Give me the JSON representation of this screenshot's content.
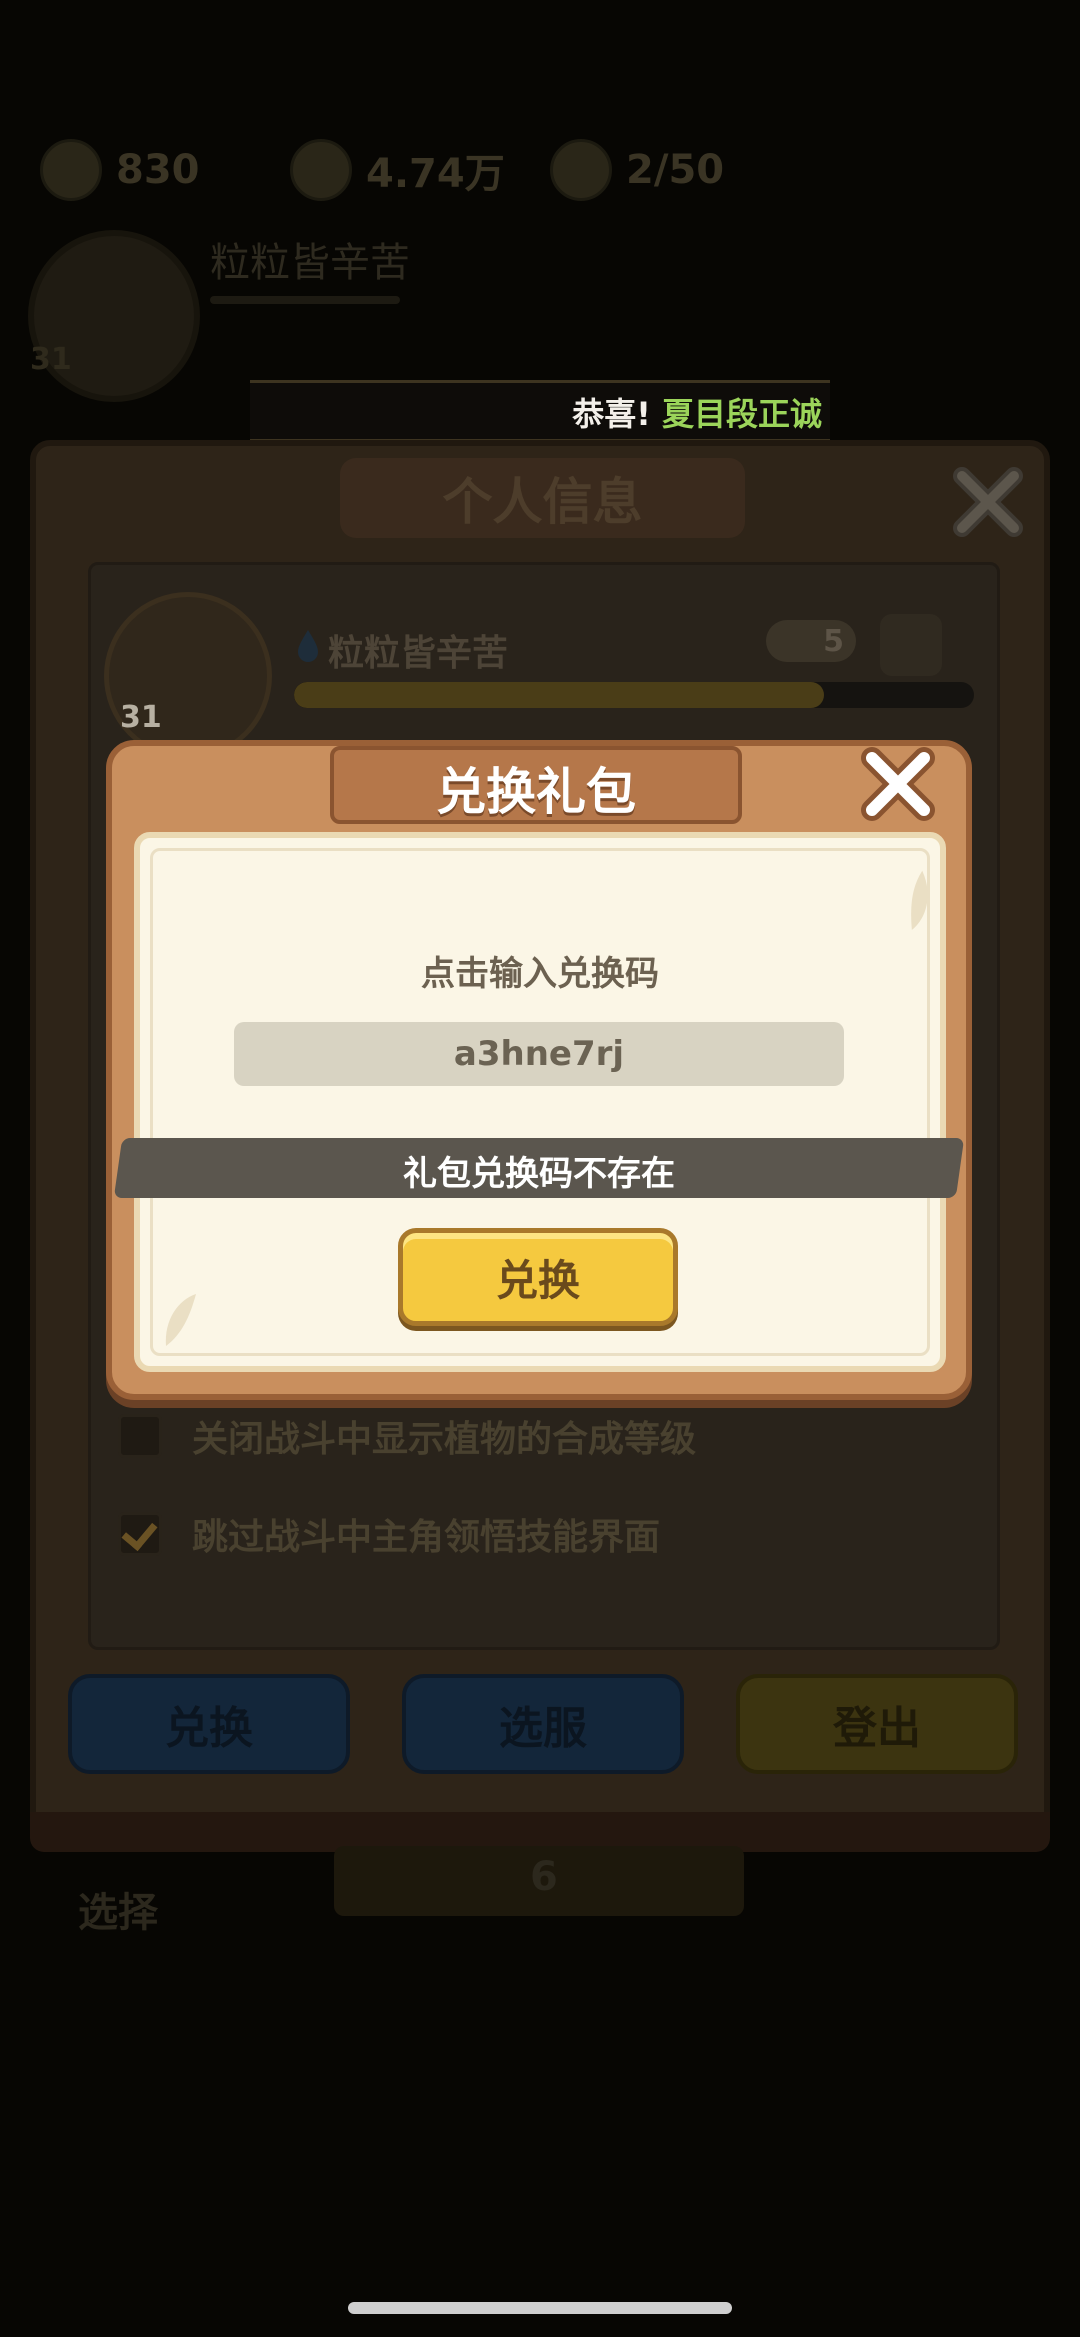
{
  "hud": {
    "stat1": "830",
    "stat2": "4.74万",
    "stat3": "2/50"
  },
  "profile_bg": {
    "level": "31",
    "name": "粒粒皆辛苦"
  },
  "marquee": {
    "prefix": "恭喜!",
    "highlight": "夏目段正诚"
  },
  "personal_info": {
    "title": "个人信息",
    "level": "31",
    "name": "粒粒皆辛苦",
    "likes": "5",
    "xp_fraction": 0.78,
    "options": [
      {
        "label": "关闭战斗中显示植物的合成等级",
        "checked": false
      },
      {
        "label": "跳过战斗中主角领悟技能界面",
        "checked": true
      }
    ],
    "buttons": {
      "redeem": "兑换",
      "select_server": "选服",
      "logout": "登出"
    }
  },
  "bg_tabs": {
    "left": "选择",
    "center_value": "6"
  },
  "redeem_dialog": {
    "title": "兑换礼包",
    "prompt": "点击输入兑换码",
    "code_value": "a3hne7rj",
    "error_toast": "礼包兑换码不存在",
    "submit_label": "兑换"
  },
  "colors": {
    "dialog_frame": "#c98f5e",
    "dialog_paper": "#fbf6e6",
    "banner": "#b5774a",
    "button_gold": "#f5c93f",
    "toast_bg": "#5b564e",
    "highlight_green": "#9bd45a"
  }
}
